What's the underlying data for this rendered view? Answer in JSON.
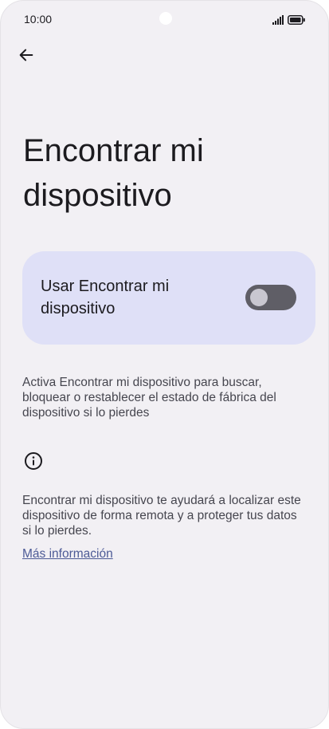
{
  "status_bar": {
    "time": "10:00",
    "icons": [
      "camera-cutout",
      "signal-icon",
      "battery-icon"
    ]
  },
  "header": {
    "back_icon": "arrow-left-icon"
  },
  "main": {
    "title": "Encontrar mi dispositivo",
    "toggle": {
      "label": "Usar Encontrar mi dispositivo",
      "state": "off"
    },
    "description": "Activa Encontrar mi dispositivo para buscar, bloquear o restablecer el estado de fábrica del dispositivo si lo pierdes",
    "info_icon": "info-icon",
    "info_text": "Encontrar mi dispositivo te ayudará a localizar este dispositivo de forma remota y a proteger tus datos si lo pierdes.",
    "more_link": "Más información"
  },
  "colors": {
    "background": "#f2f0f4",
    "card": "#dfe0f7",
    "switch_track": "#5f5e66",
    "switch_thumb": "#c9c7d0",
    "link": "#4c5a96"
  }
}
